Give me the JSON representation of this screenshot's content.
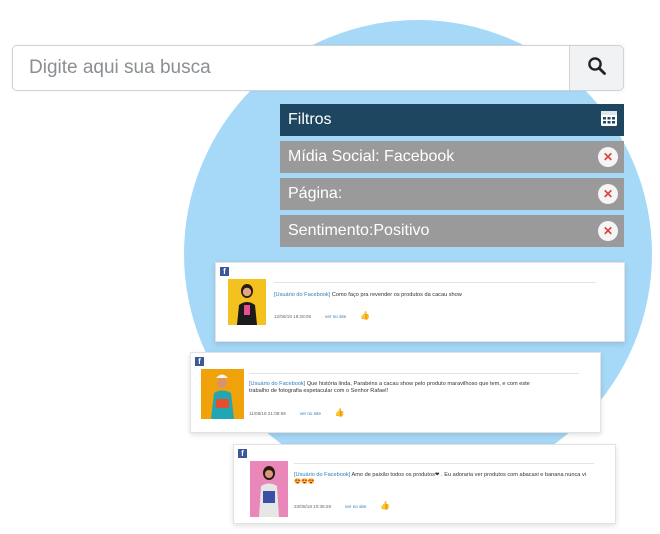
{
  "search": {
    "placeholder": "Digite aqui sua busca",
    "button_icon": "search-icon"
  },
  "filters": {
    "title": "Filtros",
    "title_icon": "calendar-icon",
    "items": [
      {
        "label": "Mídia Social: Facebook"
      },
      {
        "label": "Página:"
      },
      {
        "label": "Sentimento:Positivo"
      }
    ],
    "remove_icon": "close-icon"
  },
  "posts": [
    {
      "source_icon": "facebook-icon",
      "user": "[Usuário do Facebook]",
      "text": " Como faço pra revender os produtos da cacau show",
      "date": "12/08/18 18:28:08",
      "link": "ver no site",
      "sentiment_icon": "thumbs-up-icon"
    },
    {
      "source_icon": "facebook-icon",
      "user": "[Usuário do Facebook]",
      "text": " Que história linda, Parabéns a cacau show pelo produto maravilhoso que tem, e com este trabalho de fotografia espetacular com o Senhor Rafael!",
      "date": "11/08/18 21:08:59",
      "link": "ver no site",
      "sentiment_icon": "thumbs-up-icon"
    },
    {
      "source_icon": "facebook-icon",
      "user": "[Usuário do Facebook]",
      "text": " Amo de paixão todos os produtos❤ . Eu adoraria ver produtos com abacaxi e banana nunca vi 😍😍😍",
      "date": "23/08/18 10:36:28",
      "link": "ver no site",
      "sentiment_icon": "thumbs-up-icon"
    }
  ],
  "colors": {
    "blob": "#a6d8f7",
    "filter_header": "#1f4660",
    "filter_row": "#9a9a9a",
    "remove": "#d9443a",
    "link": "#2e7dbb"
  }
}
